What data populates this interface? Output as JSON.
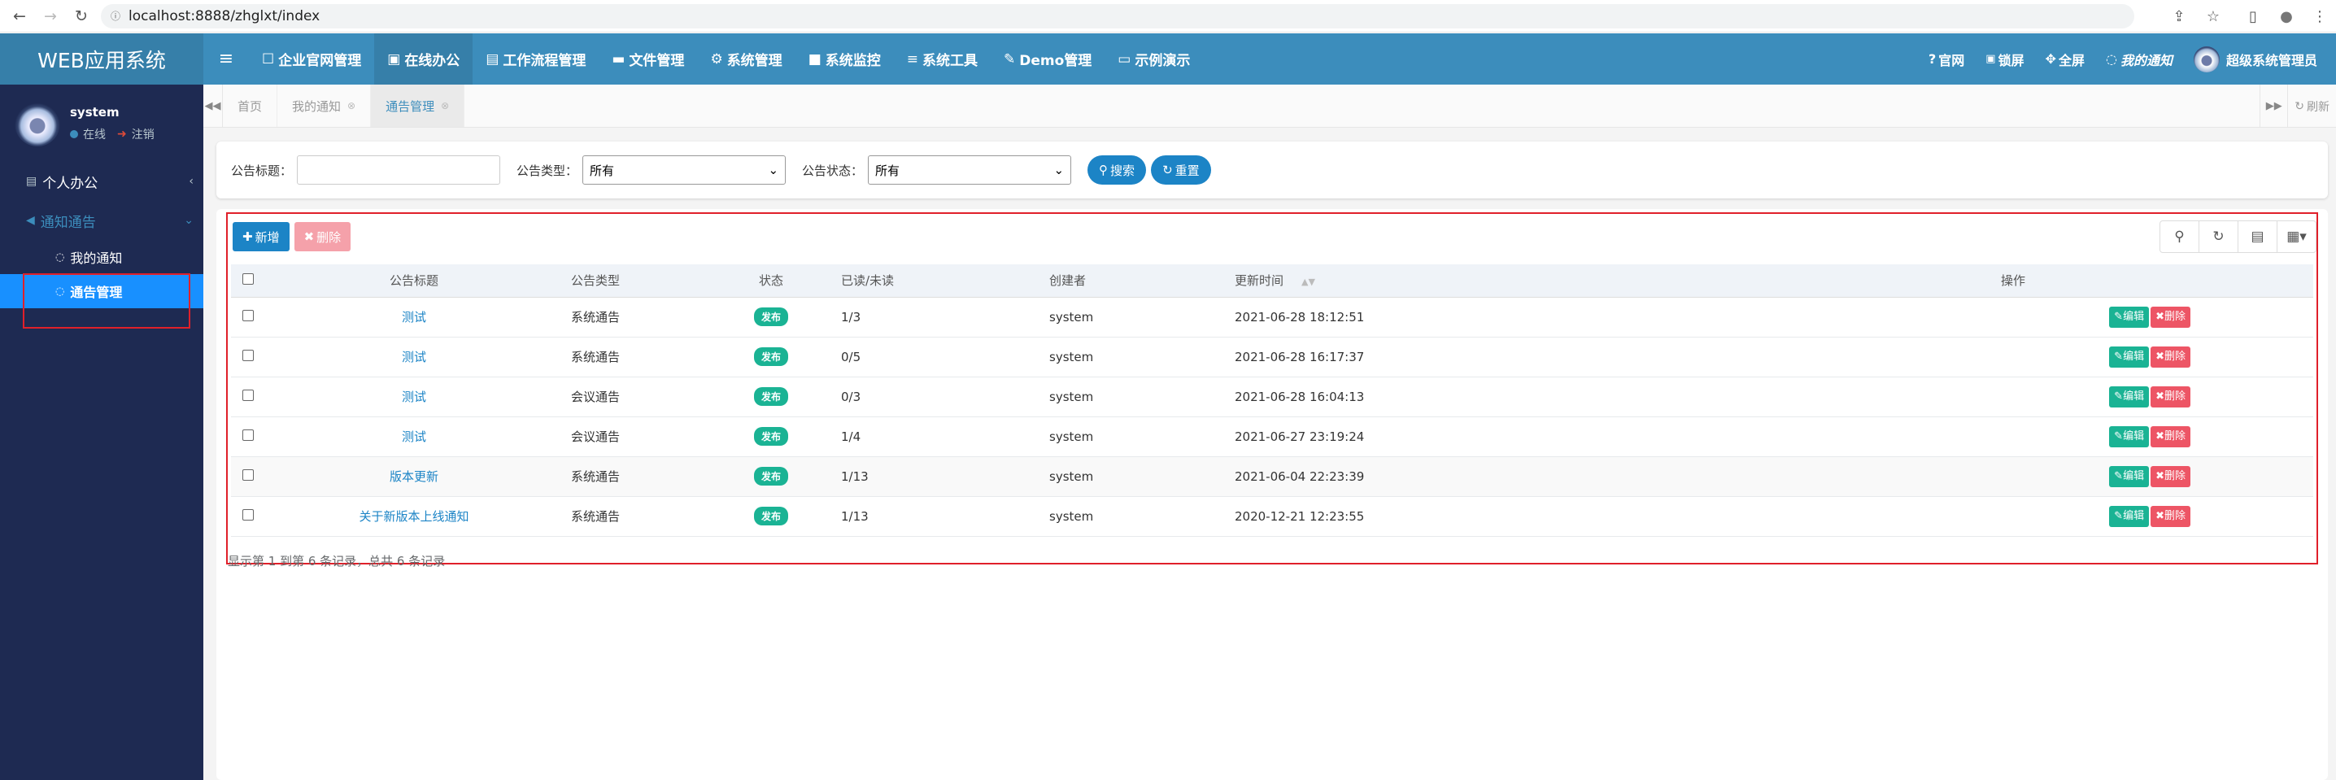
{
  "browser": {
    "url": "localhost:8888/zhglxt/index"
  },
  "app": {
    "title": "WEB应用系统"
  },
  "topnav": {
    "items": [
      {
        "icon": "☐",
        "label": "企业官网管理"
      },
      {
        "icon": "▣",
        "label": "在线办公"
      },
      {
        "icon": "▤",
        "label": "工作流程管理"
      },
      {
        "icon": "▬",
        "label": "文件管理"
      },
      {
        "icon": "⚙",
        "label": "系统管理"
      },
      {
        "icon": "■",
        "label": "系统监控"
      },
      {
        "icon": "≡",
        "label": "系统工具"
      },
      {
        "icon": "✎",
        "label": "Demo管理"
      },
      {
        "icon": "▭",
        "label": "示例演示"
      }
    ],
    "right": {
      "site": "官网",
      "lock": "锁屏",
      "fullscreen": "全屏",
      "notice": "我的通知",
      "user": "超级系统管理员"
    }
  },
  "sidebar": {
    "user": {
      "name": "system",
      "status": "在线",
      "logout": "注销"
    },
    "menu": [
      {
        "label": "个人办公"
      },
      {
        "label": "通知通告",
        "children": [
          {
            "label": "我的通知"
          },
          {
            "label": "通告管理"
          }
        ]
      }
    ]
  },
  "tabs": [
    {
      "label": "首页"
    },
    {
      "label": "我的通知"
    },
    {
      "label": "通告管理"
    }
  ],
  "tabs_refresh": "刷新",
  "search": {
    "title_label": "公告标题：",
    "title_value": "",
    "type_label": "公告类型：",
    "type_value": "所有",
    "status_label": "公告状态：",
    "status_value": "所有",
    "search_btn": "搜索",
    "reset_btn": "重置"
  },
  "toolbar": {
    "add": "新增",
    "delete": "删除"
  },
  "table": {
    "headers": {
      "title": "公告标题",
      "type": "公告类型",
      "status": "状态",
      "read": "已读/未读",
      "creator": "创建者",
      "time": "更新时间",
      "ops": "操作"
    },
    "rows": [
      {
        "title": "测试",
        "type": "系统通告",
        "status": "发布",
        "read": "1/3",
        "creator": "system",
        "time": "2021-06-28 18:12:51"
      },
      {
        "title": "测试",
        "type": "系统通告",
        "status": "发布",
        "read": "0/5",
        "creator": "system",
        "time": "2021-06-28 16:17:37"
      },
      {
        "title": "测试",
        "type": "会议通告",
        "status": "发布",
        "read": "0/3",
        "creator": "system",
        "time": "2021-06-28 16:04:13"
      },
      {
        "title": "测试",
        "type": "会议通告",
        "status": "发布",
        "read": "1/4",
        "creator": "system",
        "time": "2021-06-27 23:19:24"
      },
      {
        "title": "版本更新",
        "type": "系统通告",
        "status": "发布",
        "read": "1/13",
        "creator": "system",
        "time": "2021-06-04 22:23:39"
      },
      {
        "title": "关于新版本上线通知",
        "type": "系统通告",
        "status": "发布",
        "read": "1/13",
        "creator": "system",
        "time": "2020-12-21 12:23:55"
      }
    ],
    "edit_label": "编辑",
    "delete_label": "删除"
  },
  "pagination": {
    "text": "显示第 1 到第 6 条记录，总共 6 条记录"
  },
  "colors": {
    "topbar": "#3c8dbc",
    "sidebar": "#1e2a52",
    "primary": "#1c84c6",
    "success": "#1ab394",
    "danger": "#ed5565",
    "highlight": "#e0202a"
  }
}
